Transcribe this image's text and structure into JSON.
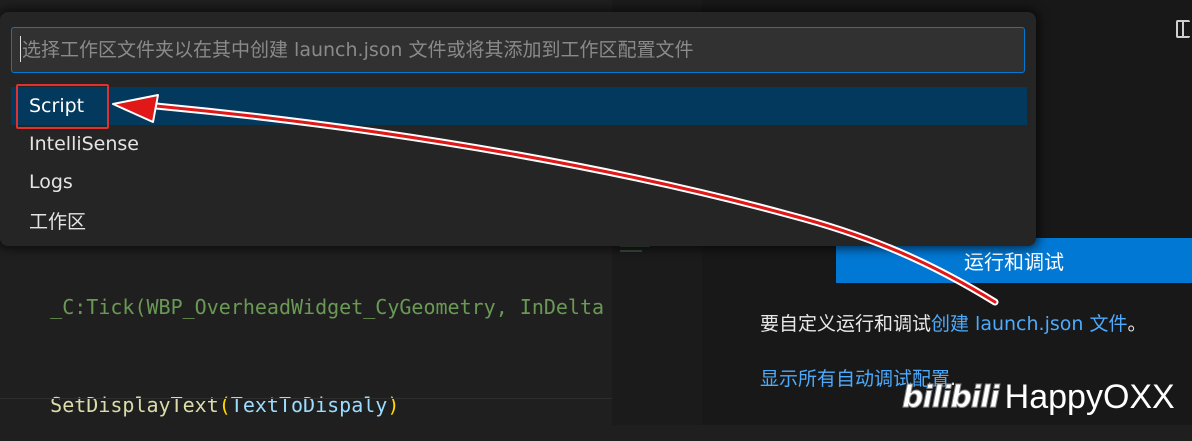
{
  "quick_pick": {
    "placeholder": "选择工作区文件夹以在其中创建 launch.json 文件或将其添加到工作区配置文件",
    "items": [
      {
        "label": "Script",
        "selected": true
      },
      {
        "label": "IntelliSense",
        "selected": false
      },
      {
        "label": "Logs",
        "selected": false
      },
      {
        "label": "工作区",
        "selected": false
      }
    ]
  },
  "editor": {
    "lines": [
      {
        "segments": [
          {
            "text": "_C:Tick(WBP_OverheadWidget_CyGeometry, InDelta",
            "role": "comment"
          }
        ]
      },
      {
        "segments": [
          {
            "text": "SetDisplayText",
            "role": "function"
          },
          {
            "text": "(",
            "role": "bracket"
          },
          {
            "text": "TextToDispaly",
            "role": "variable"
          },
          {
            "text": ")",
            "role": "bracket"
          }
        ]
      }
    ]
  },
  "run_debug": {
    "button_label": "运行和调试",
    "desc_prefix": "要自定义运行和调试",
    "desc_link": "创建 launch.json 文件",
    "desc_suffix": "。",
    "show_all_link": "显示所有自动调试配置",
    "show_all_suffix": "."
  },
  "watermark": {
    "logo_text": "bilibili",
    "user": "HappyOXX"
  },
  "colors": {
    "accent": "#0078d4",
    "selection": "#04395e",
    "link": "#4daafc",
    "annotation": "#e03030"
  }
}
